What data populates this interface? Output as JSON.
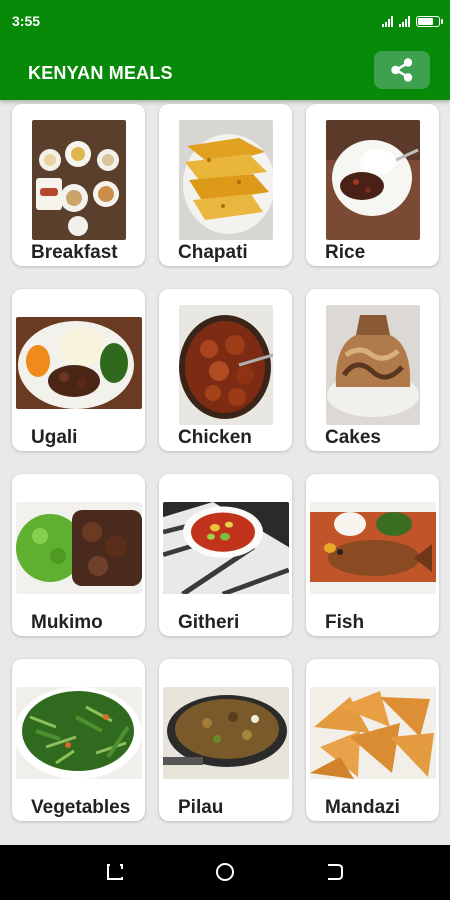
{
  "status_bar": {
    "time": "3:55"
  },
  "app_bar": {
    "title": "KENYAN MEALS",
    "share_icon": "share-icon"
  },
  "meals": [
    {
      "label": "Breakfast"
    },
    {
      "label": "Chapati"
    },
    {
      "label": "Rice"
    },
    {
      "label": "Ugali"
    },
    {
      "label": "Chicken"
    },
    {
      "label": "Cakes"
    },
    {
      "label": "Mukimo"
    },
    {
      "label": "Githeri"
    },
    {
      "label": "Fish"
    },
    {
      "label": "Vegetables"
    },
    {
      "label": "Pilau"
    },
    {
      "label": "Mandazi"
    }
  ],
  "nav": {
    "recents_icon": "recents-icon",
    "home_icon": "home-icon",
    "back_icon": "back-icon"
  },
  "colors": {
    "primary": "#078a08",
    "share_button": "#3da14f",
    "card": "#ffffff",
    "background": "#e9e9e9"
  }
}
